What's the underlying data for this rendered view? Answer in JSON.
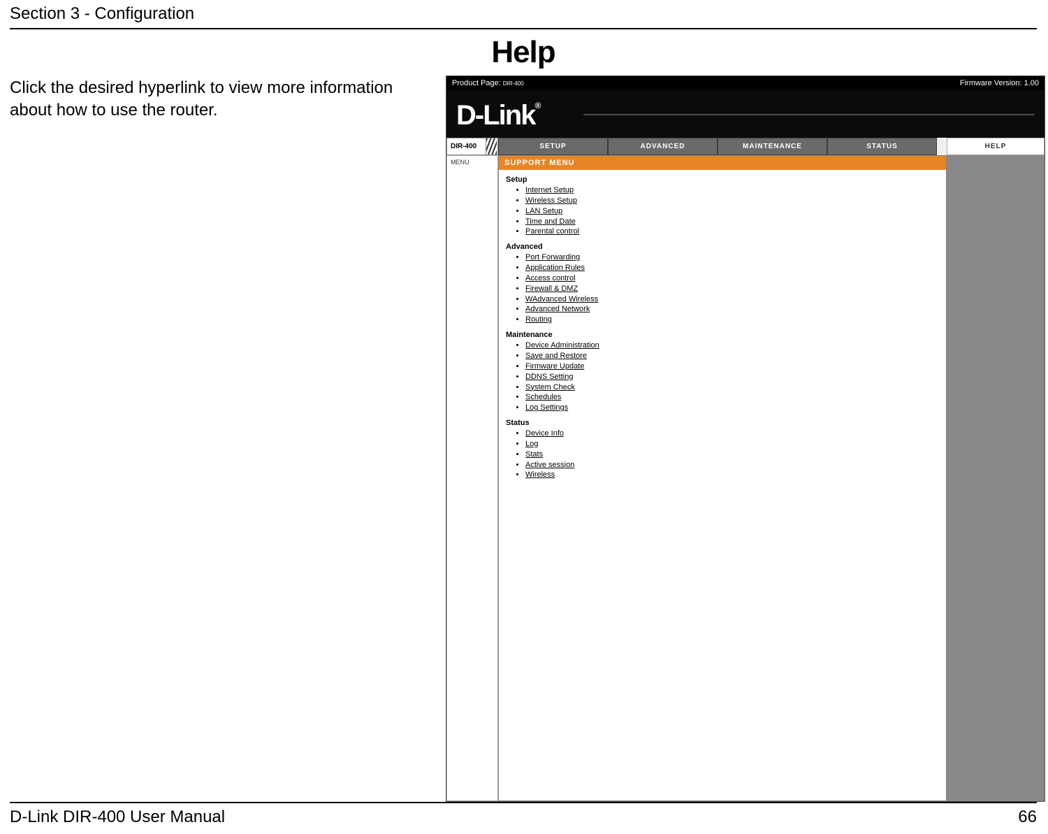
{
  "header": {
    "section": "Section 3 - Configuration"
  },
  "title": "Help",
  "blurb": "Click the desired hyperlink to view more information about how to use the router.",
  "router": {
    "productPage": {
      "label": "Product Page:",
      "model": "DIR-400"
    },
    "firmware": "Firmware Version: 1.00",
    "brand": "D-Link",
    "navModel": "DIR-400",
    "tabs": {
      "setup": "SETUP",
      "advanced": "ADVANCED",
      "maintenance": "MAINTENANCE",
      "status": "STATUS",
      "help": "HELP"
    },
    "sidebar": {
      "menu": "MENU"
    },
    "panelTitle": "SUPPORT MENU",
    "groups": [
      {
        "title": "Setup",
        "links": [
          "Internet Setup",
          "Wireless Setup",
          "LAN Setup",
          "Time and Date",
          "Parental control"
        ]
      },
      {
        "title": "Advanced",
        "links": [
          "Port Forwarding",
          "Application Rules",
          "Access control",
          "Firewall & DMZ",
          "WAdvanced Wireless",
          "Advanced Network",
          "Routing"
        ]
      },
      {
        "title": "Maintenance",
        "links": [
          "Device Administration",
          "Save and Restore",
          "Firmware Update",
          "DDNS Setting",
          "System Check",
          "Schedules",
          "Log Settings"
        ]
      },
      {
        "title": "Status",
        "links": [
          "Device Info",
          "Log",
          "Stats",
          "Active session",
          "Wireless"
        ]
      }
    ]
  },
  "footer": {
    "left": "D-Link DIR-400 User Manual",
    "right": "66"
  }
}
